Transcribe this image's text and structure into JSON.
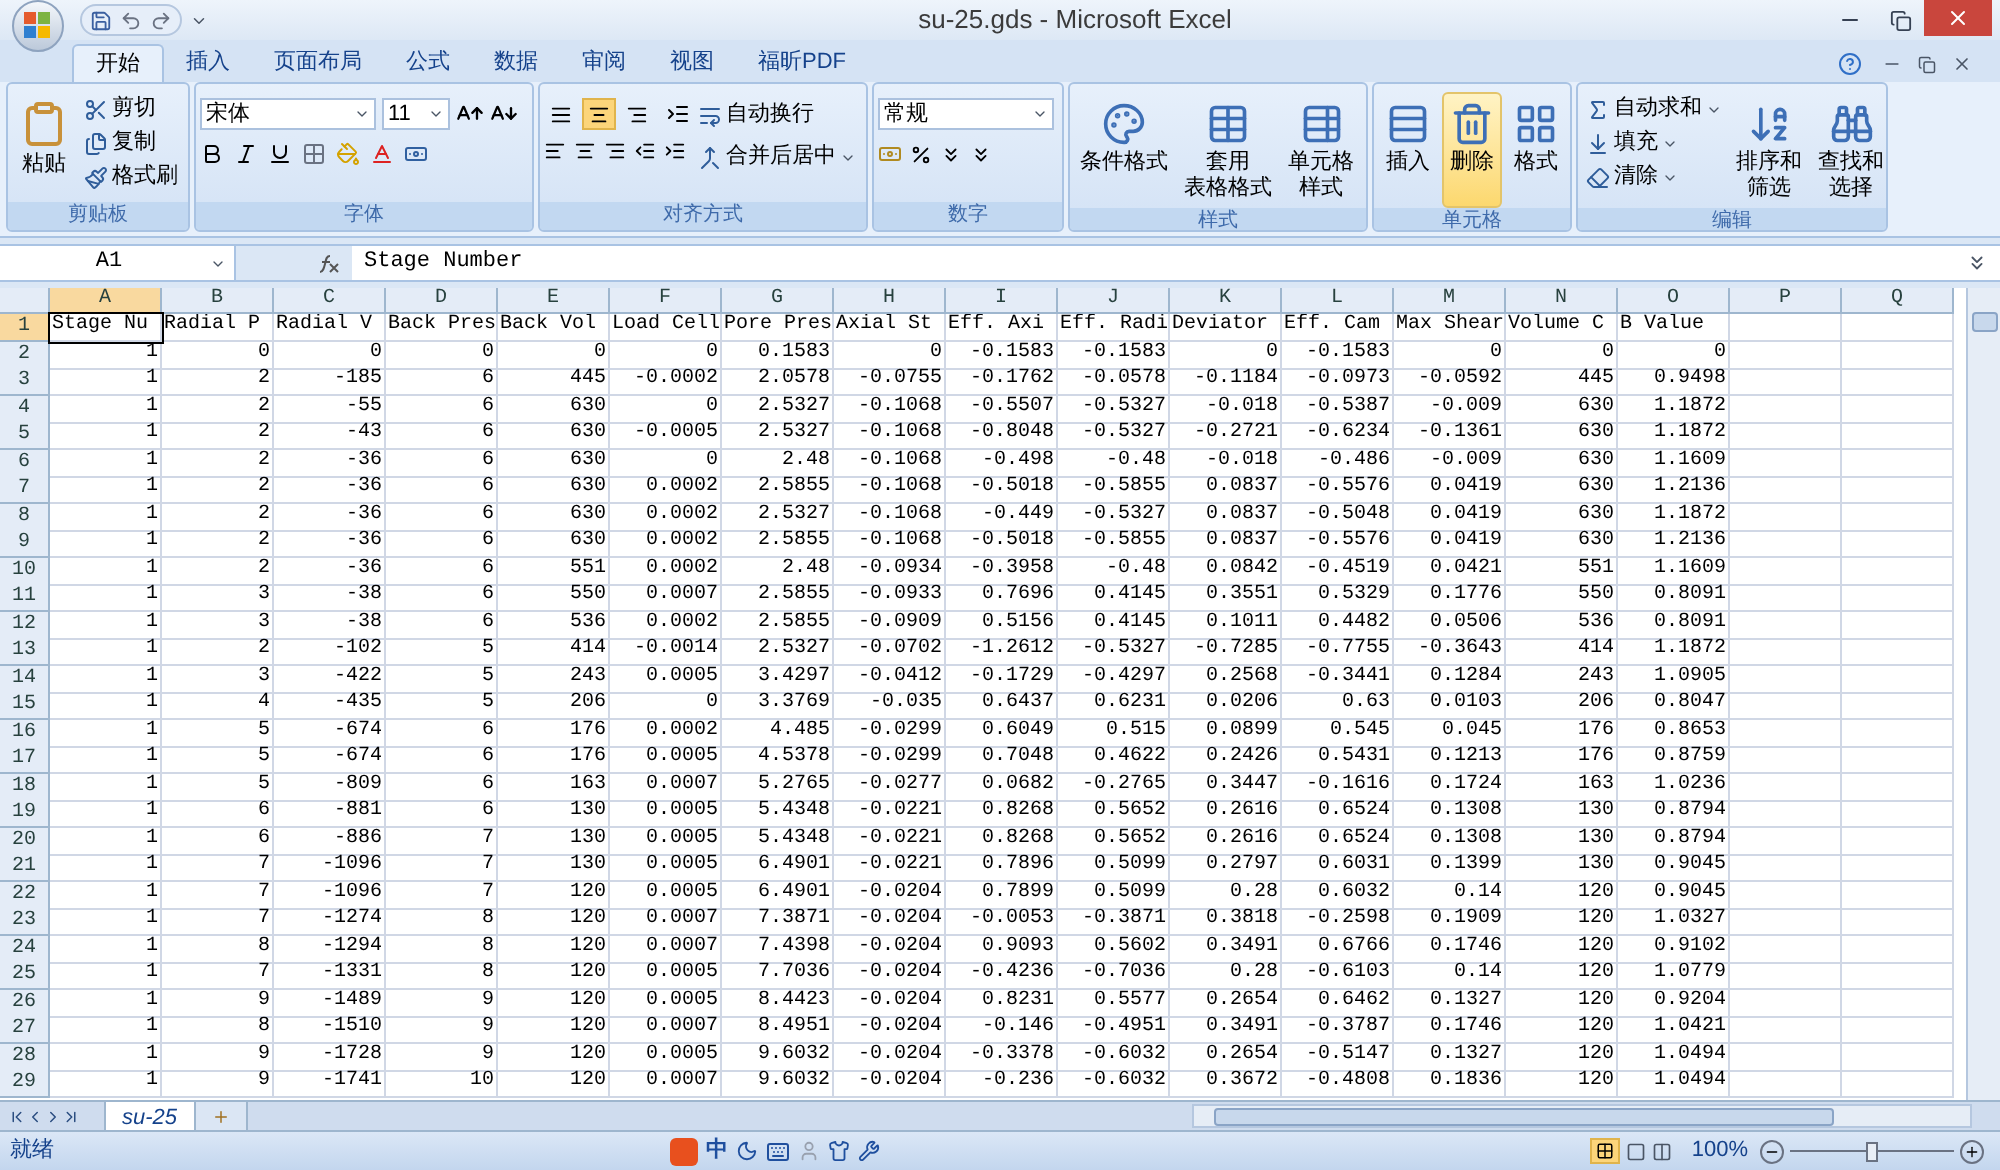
{
  "window": {
    "title": "su-25.gds - Microsoft Excel"
  },
  "ribbon_tabs": [
    {
      "label": "开始",
      "selected": true
    },
    {
      "label": "插入",
      "selected": false
    },
    {
      "label": "页面布局",
      "selected": false
    },
    {
      "label": "公式",
      "selected": false
    },
    {
      "label": "数据",
      "selected": false
    },
    {
      "label": "审阅",
      "selected": false
    },
    {
      "label": "视图",
      "selected": false
    },
    {
      "label": "福昕PDF",
      "selected": false
    }
  ],
  "clipboard": {
    "label": "剪贴板",
    "paste": "粘贴",
    "items": [
      "剪切",
      "复制",
      "格式刷"
    ]
  },
  "font": {
    "label": "字体",
    "font_name": "宋体",
    "font_size": "11"
  },
  "alignment": {
    "label": "对齐方式",
    "vertical": [
      {
        "selected": false
      },
      {
        "selected": true
      },
      {
        "selected": false
      }
    ],
    "wrap": "自动换行",
    "merge": "合并后居中"
  },
  "number": {
    "label": "数字",
    "format": "常规"
  },
  "styles": {
    "label": "样式",
    "buttons": [
      {
        "lines": [
          "条件格式"
        ]
      },
      {
        "lines": [
          "套用",
          "表格格式"
        ]
      },
      {
        "lines": [
          "单元格",
          "样式"
        ]
      }
    ]
  },
  "cells": {
    "label": "单元格",
    "buttons": [
      {
        "lines": [
          "插入"
        ],
        "hovered": false
      },
      {
        "lines": [
          "删除"
        ],
        "hovered": true
      },
      {
        "lines": [
          "格式"
        ],
        "hovered": false
      }
    ]
  },
  "editing": {
    "label": "编辑",
    "items": [
      "自动求和",
      "填充",
      "清除"
    ],
    "buttons": [
      {
        "lines": [
          "排序和",
          "筛选"
        ]
      },
      {
        "lines": [
          "查找和",
          "选择"
        ]
      }
    ]
  },
  "formula_bar": {
    "name_box": "A1",
    "formula": "Stage Number"
  },
  "sheet": {
    "columns": [
      {
        "letter": "A",
        "selected": true
      },
      {
        "letter": "B",
        "selected": false
      },
      {
        "letter": "C",
        "selected": false
      },
      {
        "letter": "D",
        "selected": false
      },
      {
        "letter": "E",
        "selected": false
      },
      {
        "letter": "F",
        "selected": false
      },
      {
        "letter": "G",
        "selected": false
      },
      {
        "letter": "H",
        "selected": false
      },
      {
        "letter": "I",
        "selected": false
      },
      {
        "letter": "J",
        "selected": false
      },
      {
        "letter": "K",
        "selected": false
      },
      {
        "letter": "L",
        "selected": false
      },
      {
        "letter": "M",
        "selected": false
      },
      {
        "letter": "N",
        "selected": false
      },
      {
        "letter": "O",
        "selected": false
      },
      {
        "letter": "P",
        "selected": false
      },
      {
        "letter": "Q",
        "selected": false
      }
    ],
    "rows": [
      {
        "number": "1",
        "selected": true,
        "kind": "header",
        "cells": [
          "Stage Nu",
          "Radial P",
          "Radial V",
          "Back Pres",
          "Back Vol",
          "Load Cell",
          "Pore Pres",
          "Axial St",
          "Eff. Axi",
          "Eff. Radi",
          "Deviator",
          "Eff. Cam",
          "Max Shear",
          "Volume C",
          "B Value"
        ]
      },
      {
        "number": "2",
        "selected": false,
        "kind": "data",
        "cells": [
          "1",
          "0",
          "0",
          "0",
          "0",
          "0",
          "0.1583",
          "0",
          "-0.1583",
          "-0.1583",
          "0",
          "-0.1583",
          "0",
          "0",
          "0"
        ]
      },
      {
        "number": "3",
        "selected": false,
        "kind": "data",
        "cells": [
          "1",
          "2",
          "-185",
          "6",
          "445",
          "-0.0002",
          "2.0578",
          "-0.0755",
          "-0.1762",
          "-0.0578",
          "-0.1184",
          "-0.0973",
          "-0.0592",
          "445",
          "0.9498"
        ]
      },
      {
        "number": "4",
        "selected": false,
        "kind": "data",
        "cells": [
          "1",
          "2",
          "-55",
          "6",
          "630",
          "0",
          "2.5327",
          "-0.1068",
          "-0.5507",
          "-0.5327",
          "-0.018",
          "-0.5387",
          "-0.009",
          "630",
          "1.1872"
        ]
      },
      {
        "number": "5",
        "selected": false,
        "kind": "data",
        "cells": [
          "1",
          "2",
          "-43",
          "6",
          "630",
          "-0.0005",
          "2.5327",
          "-0.1068",
          "-0.8048",
          "-0.5327",
          "-0.2721",
          "-0.6234",
          "-0.1361",
          "630",
          "1.1872"
        ]
      },
      {
        "number": "6",
        "selected": false,
        "kind": "data",
        "cells": [
          "1",
          "2",
          "-36",
          "6",
          "630",
          "0",
          "2.48",
          "-0.1068",
          "-0.498",
          "-0.48",
          "-0.018",
          "-0.486",
          "-0.009",
          "630",
          "1.1609"
        ]
      },
      {
        "number": "7",
        "selected": false,
        "kind": "data",
        "cells": [
          "1",
          "2",
          "-36",
          "6",
          "630",
          "0.0002",
          "2.5855",
          "-0.1068",
          "-0.5018",
          "-0.5855",
          "0.0837",
          "-0.5576",
          "0.0419",
          "630",
          "1.2136"
        ]
      },
      {
        "number": "8",
        "selected": false,
        "kind": "data",
        "cells": [
          "1",
          "2",
          "-36",
          "6",
          "630",
          "0.0002",
          "2.5327",
          "-0.1068",
          "-0.449",
          "-0.5327",
          "0.0837",
          "-0.5048",
          "0.0419",
          "630",
          "1.1872"
        ]
      },
      {
        "number": "9",
        "selected": false,
        "kind": "data",
        "cells": [
          "1",
          "2",
          "-36",
          "6",
          "630",
          "0.0002",
          "2.5855",
          "-0.1068",
          "-0.5018",
          "-0.5855",
          "0.0837",
          "-0.5576",
          "0.0419",
          "630",
          "1.2136"
        ]
      },
      {
        "number": "10",
        "selected": false,
        "kind": "data",
        "cells": [
          "1",
          "2",
          "-36",
          "6",
          "551",
          "0.0002",
          "2.48",
          "-0.0934",
          "-0.3958",
          "-0.48",
          "0.0842",
          "-0.4519",
          "0.0421",
          "551",
          "1.1609"
        ]
      },
      {
        "number": "11",
        "selected": false,
        "kind": "data",
        "cells": [
          "1",
          "3",
          "-38",
          "6",
          "550",
          "0.0007",
          "2.5855",
          "-0.0933",
          "0.7696",
          "0.4145",
          "0.3551",
          "0.5329",
          "0.1776",
          "550",
          "0.8091"
        ]
      },
      {
        "number": "12",
        "selected": false,
        "kind": "data",
        "cells": [
          "1",
          "3",
          "-38",
          "6",
          "536",
          "0.0002",
          "2.5855",
          "-0.0909",
          "0.5156",
          "0.4145",
          "0.1011",
          "0.4482",
          "0.0506",
          "536",
          "0.8091"
        ]
      },
      {
        "number": "13",
        "selected": false,
        "kind": "data",
        "cells": [
          "1",
          "2",
          "-102",
          "5",
          "414",
          "-0.0014",
          "2.5327",
          "-0.0702",
          "-1.2612",
          "-0.5327",
          "-0.7285",
          "-0.7755",
          "-0.3643",
          "414",
          "1.1872"
        ]
      },
      {
        "number": "14",
        "selected": false,
        "kind": "data",
        "cells": [
          "1",
          "3",
          "-422",
          "5",
          "243",
          "0.0005",
          "3.4297",
          "-0.0412",
          "-0.1729",
          "-0.4297",
          "0.2568",
          "-0.3441",
          "0.1284",
          "243",
          "1.0905"
        ]
      },
      {
        "number": "15",
        "selected": false,
        "kind": "data",
        "cells": [
          "1",
          "4",
          "-435",
          "5",
          "206",
          "0",
          "3.3769",
          "-0.035",
          "0.6437",
          "0.6231",
          "0.0206",
          "0.63",
          "0.0103",
          "206",
          "0.8047"
        ]
      },
      {
        "number": "16",
        "selected": false,
        "kind": "data",
        "cells": [
          "1",
          "5",
          "-674",
          "6",
          "176",
          "0.0002",
          "4.485",
          "-0.0299",
          "0.6049",
          "0.515",
          "0.0899",
          "0.545",
          "0.045",
          "176",
          "0.8653"
        ]
      },
      {
        "number": "17",
        "selected": false,
        "kind": "data",
        "cells": [
          "1",
          "5",
          "-674",
          "6",
          "176",
          "0.0005",
          "4.5378",
          "-0.0299",
          "0.7048",
          "0.4622",
          "0.2426",
          "0.5431",
          "0.1213",
          "176",
          "0.8759"
        ]
      },
      {
        "number": "18",
        "selected": false,
        "kind": "data",
        "cells": [
          "1",
          "5",
          "-809",
          "6",
          "163",
          "0.0007",
          "5.2765",
          "-0.0277",
          "0.0682",
          "-0.2765",
          "0.3447",
          "-0.1616",
          "0.1724",
          "163",
          "1.0236"
        ]
      },
      {
        "number": "19",
        "selected": false,
        "kind": "data",
        "cells": [
          "1",
          "6",
          "-881",
          "6",
          "130",
          "0.0005",
          "5.4348",
          "-0.0221",
          "0.8268",
          "0.5652",
          "0.2616",
          "0.6524",
          "0.1308",
          "130",
          "0.8794"
        ]
      },
      {
        "number": "20",
        "selected": false,
        "kind": "data",
        "cells": [
          "1",
          "6",
          "-886",
          "7",
          "130",
          "0.0005",
          "5.4348",
          "-0.0221",
          "0.8268",
          "0.5652",
          "0.2616",
          "0.6524",
          "0.1308",
          "130",
          "0.8794"
        ]
      },
      {
        "number": "21",
        "selected": false,
        "kind": "data",
        "cells": [
          "1",
          "7",
          "-1096",
          "7",
          "130",
          "0.0005",
          "6.4901",
          "-0.0221",
          "0.7896",
          "0.5099",
          "0.2797",
          "0.6031",
          "0.1399",
          "130",
          "0.9045"
        ]
      },
      {
        "number": "22",
        "selected": false,
        "kind": "data",
        "cells": [
          "1",
          "7",
          "-1096",
          "7",
          "120",
          "0.0005",
          "6.4901",
          "-0.0204",
          "0.7899",
          "0.5099",
          "0.28",
          "0.6032",
          "0.14",
          "120",
          "0.9045"
        ]
      },
      {
        "number": "23",
        "selected": false,
        "kind": "data",
        "cells": [
          "1",
          "7",
          "-1274",
          "8",
          "120",
          "0.0007",
          "7.3871",
          "-0.0204",
          "-0.0053",
          "-0.3871",
          "0.3818",
          "-0.2598",
          "0.1909",
          "120",
          "1.0327"
        ]
      },
      {
        "number": "24",
        "selected": false,
        "kind": "data",
        "cells": [
          "1",
          "8",
          "-1294",
          "8",
          "120",
          "0.0007",
          "7.4398",
          "-0.0204",
          "0.9093",
          "0.5602",
          "0.3491",
          "0.6766",
          "0.1746",
          "120",
          "0.9102"
        ]
      },
      {
        "number": "25",
        "selected": false,
        "kind": "data",
        "cells": [
          "1",
          "7",
          "-1331",
          "8",
          "120",
          "0.0005",
          "7.7036",
          "-0.0204",
          "-0.4236",
          "-0.7036",
          "0.28",
          "-0.6103",
          "0.14",
          "120",
          "1.0779"
        ]
      },
      {
        "number": "26",
        "selected": false,
        "kind": "data",
        "cells": [
          "1",
          "9",
          "-1489",
          "9",
          "120",
          "0.0005",
          "8.4423",
          "-0.0204",
          "0.8231",
          "0.5577",
          "0.2654",
          "0.6462",
          "0.1327",
          "120",
          "0.9204"
        ]
      },
      {
        "number": "27",
        "selected": false,
        "kind": "data",
        "cells": [
          "1",
          "8",
          "-1510",
          "9",
          "120",
          "0.0007",
          "8.4951",
          "-0.0204",
          "-0.146",
          "-0.4951",
          "0.3491",
          "-0.3787",
          "0.1746",
          "120",
          "1.0421"
        ]
      },
      {
        "number": "28",
        "selected": false,
        "kind": "data",
        "cells": [
          "1",
          "9",
          "-1728",
          "9",
          "120",
          "0.0005",
          "9.6032",
          "-0.0204",
          "-0.3378",
          "-0.6032",
          "0.2654",
          "-0.5147",
          "0.1327",
          "120",
          "1.0494"
        ]
      },
      {
        "number": "29",
        "selected": false,
        "kind": "data",
        "cells": [
          "1",
          "9",
          "-1741",
          "10",
          "120",
          "0.0007",
          "9.6032",
          "-0.0204",
          "-0.236",
          "-0.6032",
          "0.3672",
          "-0.4808",
          "0.1836",
          "120",
          "1.0494"
        ]
      }
    ]
  },
  "sheet_tabs": [
    {
      "label": "su-25",
      "selected": true
    }
  ],
  "status_bar": {
    "status": "就绪",
    "ime": "中",
    "zoom": {
      "reading": "100%",
      "level": 0.5
    }
  }
}
